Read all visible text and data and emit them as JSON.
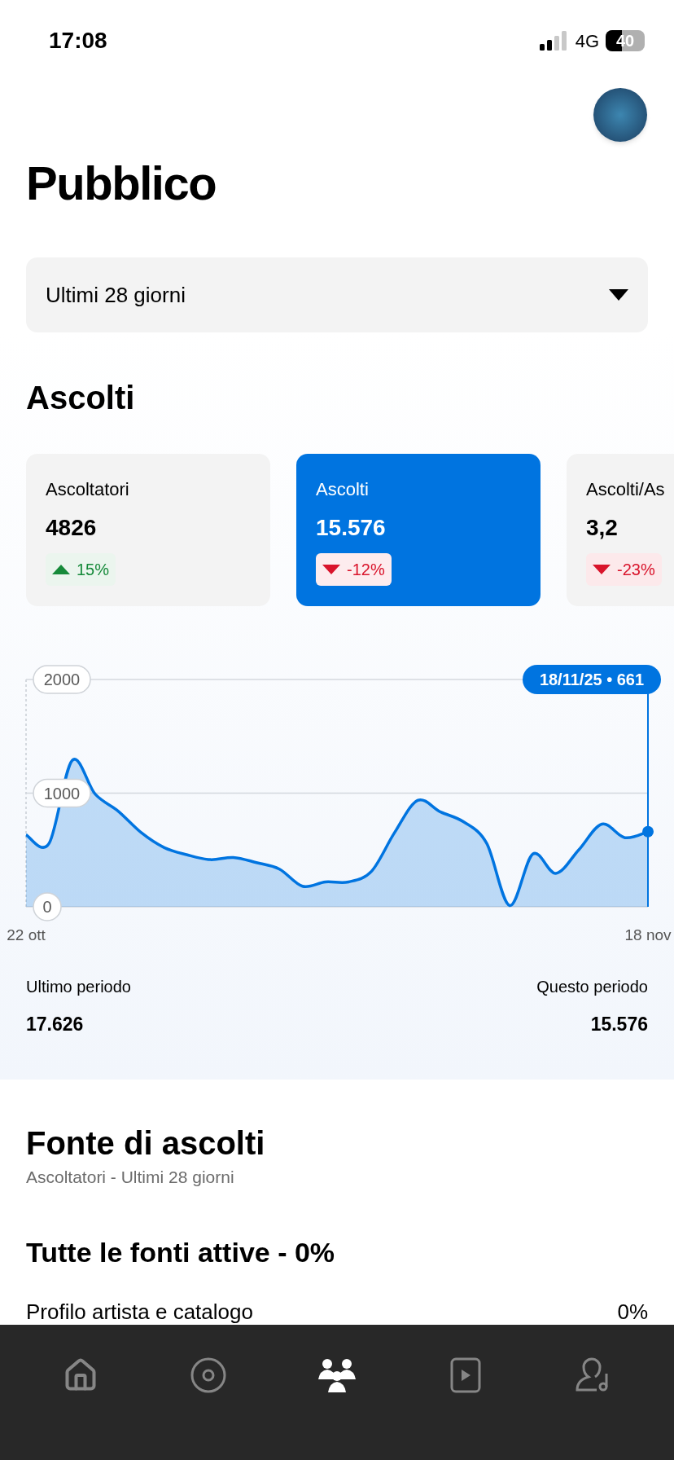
{
  "status_bar": {
    "time": "17:08",
    "network": "4G",
    "battery": "40"
  },
  "title": "Pubblico",
  "period_select": {
    "value": "Ultimi 28 giorni"
  },
  "streams": {
    "heading": "Ascolti",
    "cards": [
      {
        "label": "Ascoltatori",
        "value": "4826",
        "change": "15%",
        "kind": "increase",
        "selected": false
      },
      {
        "label": "Ascolti",
        "value": "15.576",
        "change": "-12%",
        "kind": "decrease",
        "selected": true
      },
      {
        "label": "Ascolti/As",
        "value": "3,2",
        "change": "-23%",
        "kind": "decrease",
        "selected": false
      }
    ],
    "chart": {
      "tooltip": "18/11/25 • 661",
      "chart_data": {
        "type": "area",
        "categories": [
          "22 ott",
          null,
          null,
          null,
          null,
          null,
          null,
          null,
          null,
          null,
          null,
          null,
          null,
          null,
          null,
          null,
          null,
          null,
          null,
          null,
          null,
          null,
          null,
          null,
          null,
          null,
          null,
          "18 nov"
        ],
        "series": [
          {
            "color": "#0074e0",
            "values": [
              634,
              558,
              1287,
              992,
              842,
              653,
              521,
              457,
              415,
              434,
              389,
              332,
              181,
              219,
              219,
              313,
              653,
              936,
              834,
              747,
              558,
              11,
              464,
              294,
              502,
              728,
              608,
              661
            ]
          }
        ],
        "ylim": [
          0,
          2000
        ],
        "yticks": [
          0,
          1000,
          2000
        ]
      }
    },
    "previous": {
      "label": "Ultimo periodo",
      "value": "17.626"
    },
    "current": {
      "label": "Questo periodo",
      "value": "15.576"
    }
  },
  "sources": {
    "heading": "Fonte di ascolti",
    "subtitle": "Ascoltatori - Ultimi 28 giorni",
    "summary": "Tutte le fonti attive - 0%",
    "rows": [
      {
        "label": "Profilo artista e catalogo",
        "value": "0%"
      }
    ]
  },
  "nav": [
    {
      "kind": "home",
      "selected": false
    },
    {
      "kind": "music",
      "selected": false
    },
    {
      "kind": "audience",
      "selected": true
    },
    {
      "kind": "video",
      "selected": false
    },
    {
      "kind": "artist",
      "selected": false
    }
  ]
}
